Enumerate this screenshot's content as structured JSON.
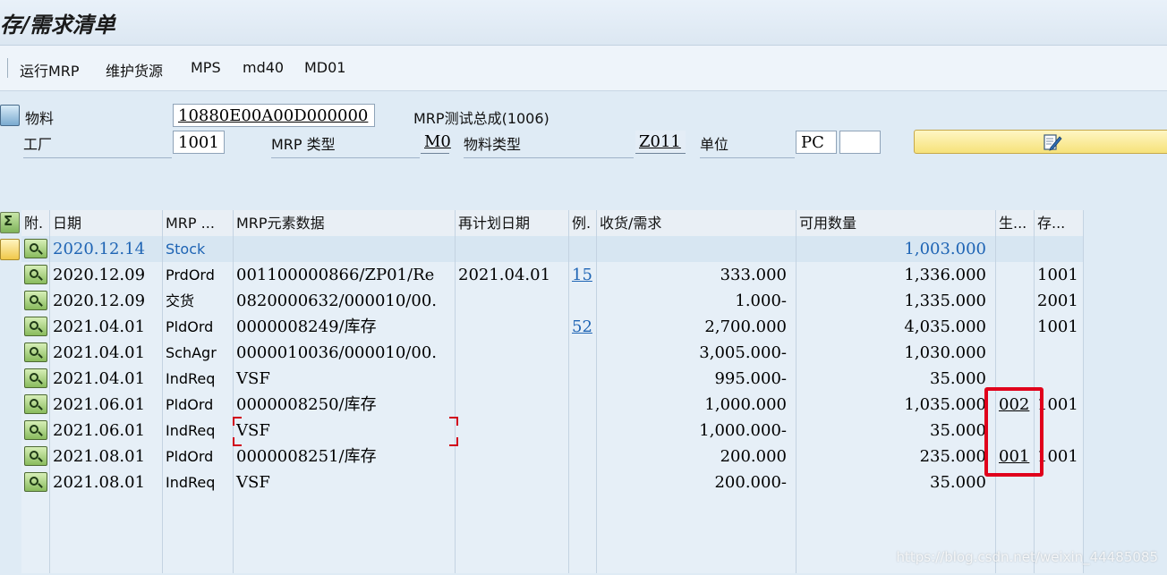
{
  "title": "存/需求清单",
  "toolbar": {
    "buttons": [
      "运行MRP",
      "维护货源",
      "MPS",
      "md40",
      "MD01"
    ]
  },
  "header": {
    "material_label": "物料",
    "material_value": "10880E00A00D000000",
    "material_desc": "MRP测试总成(1006)",
    "plant_label": "工厂",
    "plant_value": "1001",
    "mrp_type_label": "MRP 类型",
    "mrp_type_value": "M0",
    "mat_type_label": "物料类型",
    "mat_type_value": "Z011",
    "unit_label": "单位",
    "unit_value": "PC",
    "unit_extra": ""
  },
  "grid": {
    "headers": [
      "附.",
      "日期",
      "MRP ...",
      "MRP元素数据",
      "再计划日期",
      "例.",
      "收货/需求",
      "可用数量",
      "生...",
      "存..."
    ],
    "rows": [
      {
        "date": "2020.12.14",
        "elem": "Stock",
        "data": "",
        "resched": "",
        "ex": "",
        "qty": "",
        "avail": "1,003.000",
        "prod": "",
        "stor": "",
        "stock": true
      },
      {
        "date": "2020.12.09",
        "elem": "PrdOrd",
        "data": "001100000866/ZP01/Re",
        "resched": "2021.04.01",
        "ex": "15",
        "qty": "333.000",
        "avail": "1,336.000",
        "prod": "",
        "stor": "1001"
      },
      {
        "date": "2020.12.09",
        "elem": "交货",
        "data": "0820000632/000010/00.",
        "resched": "",
        "ex": "",
        "qty": "1.000-",
        "avail": "1,335.000",
        "prod": "",
        "stor": "2001"
      },
      {
        "date": "2021.04.01",
        "elem": "PldOrd",
        "data": "0000008249/库存",
        "resched": "",
        "ex": "52",
        "qty": "2,700.000",
        "avail": "4,035.000",
        "prod": "",
        "stor": "1001"
      },
      {
        "date": "2021.04.01",
        "elem": "SchAgr",
        "data": "0000010036/000010/00.",
        "resched": "",
        "ex": "",
        "qty": "3,005.000-",
        "avail": "1,030.000",
        "prod": "",
        "stor": ""
      },
      {
        "date": "2021.04.01",
        "elem": "IndReq",
        "data": "VSF",
        "resched": "",
        "ex": "",
        "qty": "995.000-",
        "avail": "35.000",
        "prod": "",
        "stor": ""
      },
      {
        "date": "2021.06.01",
        "elem": "PldOrd",
        "data": "0000008250/库存",
        "resched": "",
        "ex": "",
        "qty": "1,000.000",
        "avail": "1,035.000",
        "prod": "002",
        "stor": "1001"
      },
      {
        "date": "2021.06.01",
        "elem": "IndReq",
        "data": "VSF",
        "resched": "",
        "ex": "",
        "qty": "1,000.000-",
        "avail": "35.000",
        "prod": "",
        "stor": ""
      },
      {
        "date": "2021.08.01",
        "elem": "PldOrd",
        "data": "0000008251/库存",
        "resched": "",
        "ex": "",
        "qty": "200.000",
        "avail": "235.000",
        "prod": "001",
        "stor": "1001"
      },
      {
        "date": "2021.08.01",
        "elem": "IndReq",
        "data": "VSF",
        "resched": "",
        "ex": "",
        "qty": "200.000-",
        "avail": "35.000",
        "prod": "",
        "stor": ""
      }
    ]
  },
  "watermark": "https://blog.csdn.net/weixin_44485085"
}
